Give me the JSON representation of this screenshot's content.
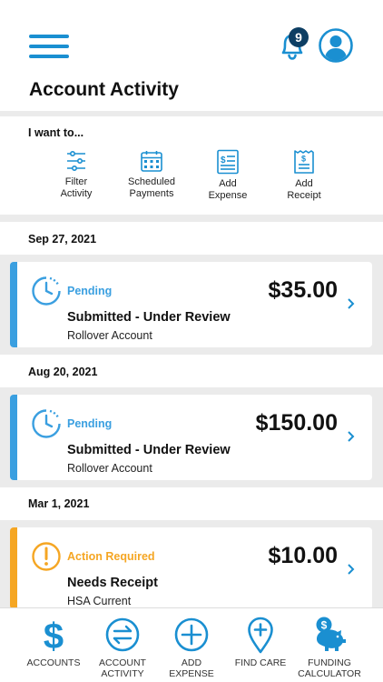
{
  "header": {
    "title": "Account Activity",
    "notification_count": "9"
  },
  "iwant": {
    "label": "I want to...",
    "actions": [
      {
        "label": "Filter\nActivity",
        "icon": "sliders-icon"
      },
      {
        "label": "Scheduled\nPayments",
        "icon": "calendar-icon"
      },
      {
        "label": "Add\nExpense",
        "icon": "document-icon"
      },
      {
        "label": "Add\nReceipt",
        "icon": "receipt-icon"
      }
    ]
  },
  "activity": [
    {
      "date": "Sep 27, 2021",
      "status": "Pending",
      "amount": "$35.00",
      "title": "Submitted - Under Review",
      "account": "Rollover Account",
      "status_color": "#3a9fe0"
    },
    {
      "date": "Aug 20, 2021",
      "status": "Pending",
      "amount": "$150.00",
      "title": "Submitted - Under Review",
      "account": "Rollover Account",
      "status_color": "#3a9fe0"
    },
    {
      "date": "Mar 1, 2021",
      "status": "Action Required",
      "amount": "$10.00",
      "title": "Needs Receipt",
      "account": "HSA Current",
      "status_color": "#f5a623"
    }
  ],
  "tabs": [
    {
      "label": "ACCOUNTS",
      "icon": "dollar-icon"
    },
    {
      "label": "ACCOUNT\nACTIVITY",
      "icon": "transfer-icon"
    },
    {
      "label": "ADD\nEXPENSE",
      "icon": "plus-circle-icon"
    },
    {
      "label": "FIND CARE",
      "icon": "location-pin-icon"
    },
    {
      "label": "FUNDING\nCALCULATOR",
      "icon": "piggy-bank-icon"
    }
  ],
  "colors": {
    "accent": "#1a8fd1",
    "pending": "#3a9fe0",
    "action_required": "#f5a623",
    "badge": "#0d3e63"
  }
}
